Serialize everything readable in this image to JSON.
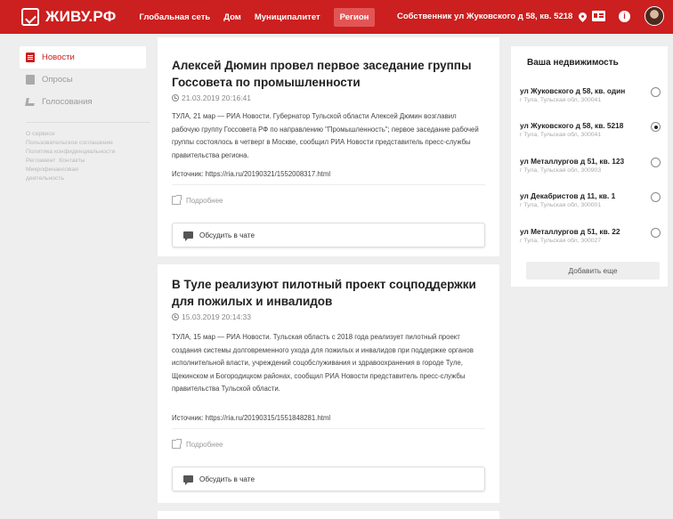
{
  "header": {
    "logo": "ЖИВУ.РФ",
    "nav": [
      {
        "label": "Глобальная сеть",
        "active": false
      },
      {
        "label": "Дом",
        "active": false
      },
      {
        "label": "Муниципалитет",
        "active": false
      },
      {
        "label": "Регион",
        "active": true
      }
    ],
    "owner": "Собственник ул Жуковского д 58, кв. 5218",
    "accent": "#cc1f1f"
  },
  "sidebar": {
    "items": [
      {
        "label": "Новости",
        "icon": "news-icon",
        "active": true
      },
      {
        "label": "Опросы",
        "icon": "poll-icon",
        "active": false
      },
      {
        "label": "Голосования",
        "icon": "vote-icon",
        "active": false
      }
    ],
    "links": [
      "О сервисе",
      "Пользовательское соглашение",
      "Политика конфиденциальности",
      "Регламент",
      "Контакты",
      "Микрофинансовая деятельность"
    ]
  },
  "articles": [
    {
      "title": "Алексей Дюмин провел первое заседание группы Госсовета по промышленности",
      "date": "21.03.2019 20:16:41",
      "body": "ТУЛА, 21 мар — РИА Новости. Губернатор Тульской области Алексей Дюмин возглавил рабочую группу Госсовета РФ по направлению \"Промышленность\"; первое заседание рабочей группы состоялось в четверг в Москве, сообщил РИА Новости представитель пресс-службы правительства региона.",
      "source": "Источник: https://ria.ru/20190321/1552008317.html",
      "more": "Подробнее",
      "chat": "Обсудить в чате"
    },
    {
      "title": "В Туле реализуют пилотный проект соцподдержки для пожилых и инвалидов",
      "date": "15.03.2019 20:14:33",
      "body": "ТУЛА, 15 мар — РИА Новости. Тульская область с 2018 года реализует пилотный проект создания системы долговременного ухода для пожилых и инвалидов при поддержке органов исполнительной власти, учреждений соцобслуживания и здравоохранения в городе Туле, Щекинском и Богородицком районах, сообщил РИА Новости представитель пресс-службы правительства Тульской области.",
      "source": "Источник: https://ria.ru/20190315/1551848281.html",
      "more": "Подробнее",
      "chat": "Обсудить в чате"
    }
  ],
  "property": {
    "title": "Ваша недвижимость",
    "items": [
      {
        "name": "ул Жуковского д 58, кв. один",
        "address": "г Тула, Тульская обл, 300041",
        "selected": false
      },
      {
        "name": "ул Жуковского д 58, кв. 5218",
        "address": "г Тула, Тульская обл, 300041",
        "selected": true
      },
      {
        "name": "ул Металлургов д 51, кв. 123",
        "address": "г Тула, Тульская обл, 300903",
        "selected": false
      },
      {
        "name": "ул Декабристов д 11, кв. 1",
        "address": "г Тула, Тульская обл, 300001",
        "selected": false
      },
      {
        "name": "ул Металлургов д 51, кв. 22",
        "address": "г Тула, Тульская обл, 300027",
        "selected": false
      }
    ],
    "add_label": "Добавить еще"
  }
}
